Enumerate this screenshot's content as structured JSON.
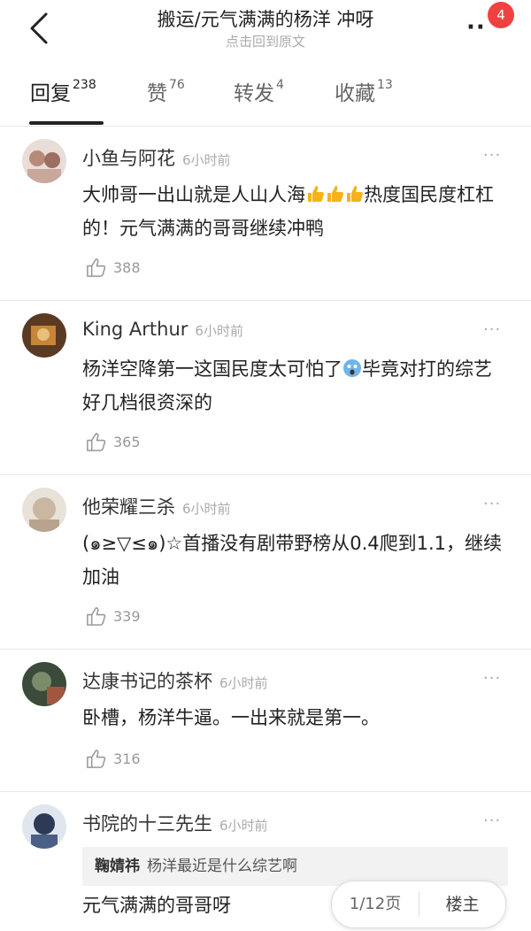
{
  "header": {
    "title": "搬运/元气满满的杨洋 冲呀",
    "subtitle": "点击回到原文",
    "badge": "4"
  },
  "tabs": [
    {
      "label": "回复",
      "count": "238",
      "active": true
    },
    {
      "label": "赞",
      "count": "76"
    },
    {
      "label": "转发",
      "count": "4"
    },
    {
      "label": "收藏",
      "count": "13"
    }
  ],
  "comments": [
    {
      "user": "小鱼与阿花",
      "time": "6小时前",
      "text_a": "大帅哥一出山就是人山人海",
      "text_b": "热度国民度杠杠的！元气满满的哥哥继续冲鸭",
      "likes": "388"
    },
    {
      "user": "King Arthur",
      "time": "6小时前",
      "text_a": "杨洋空降第一这国民度太可怕了",
      "text_b": "毕竟对打的综艺好几档很资深的",
      "likes": "365"
    },
    {
      "user": "他荣耀三杀",
      "time": "6小时前",
      "text": "(๑≥▽≤๑)☆首播没有剧带野榜从0.4爬到1.1，继续加油",
      "likes": "339"
    },
    {
      "user": "达康书记的茶杯",
      "time": "6小时前",
      "text": "卧槽，杨洋牛逼。一出来就是第一。",
      "likes": "316"
    },
    {
      "user": "书院的十三先生",
      "time": "6小时前",
      "quote_user": "鞠婧祎",
      "quote_text": "杨洋最近是什么综艺啊",
      "text": "元气满满的哥哥呀"
    }
  ],
  "pager": {
    "page": "1/12页",
    "floor": "楼主"
  },
  "colors": {
    "badge": "#f04141",
    "accent": "#222222"
  }
}
